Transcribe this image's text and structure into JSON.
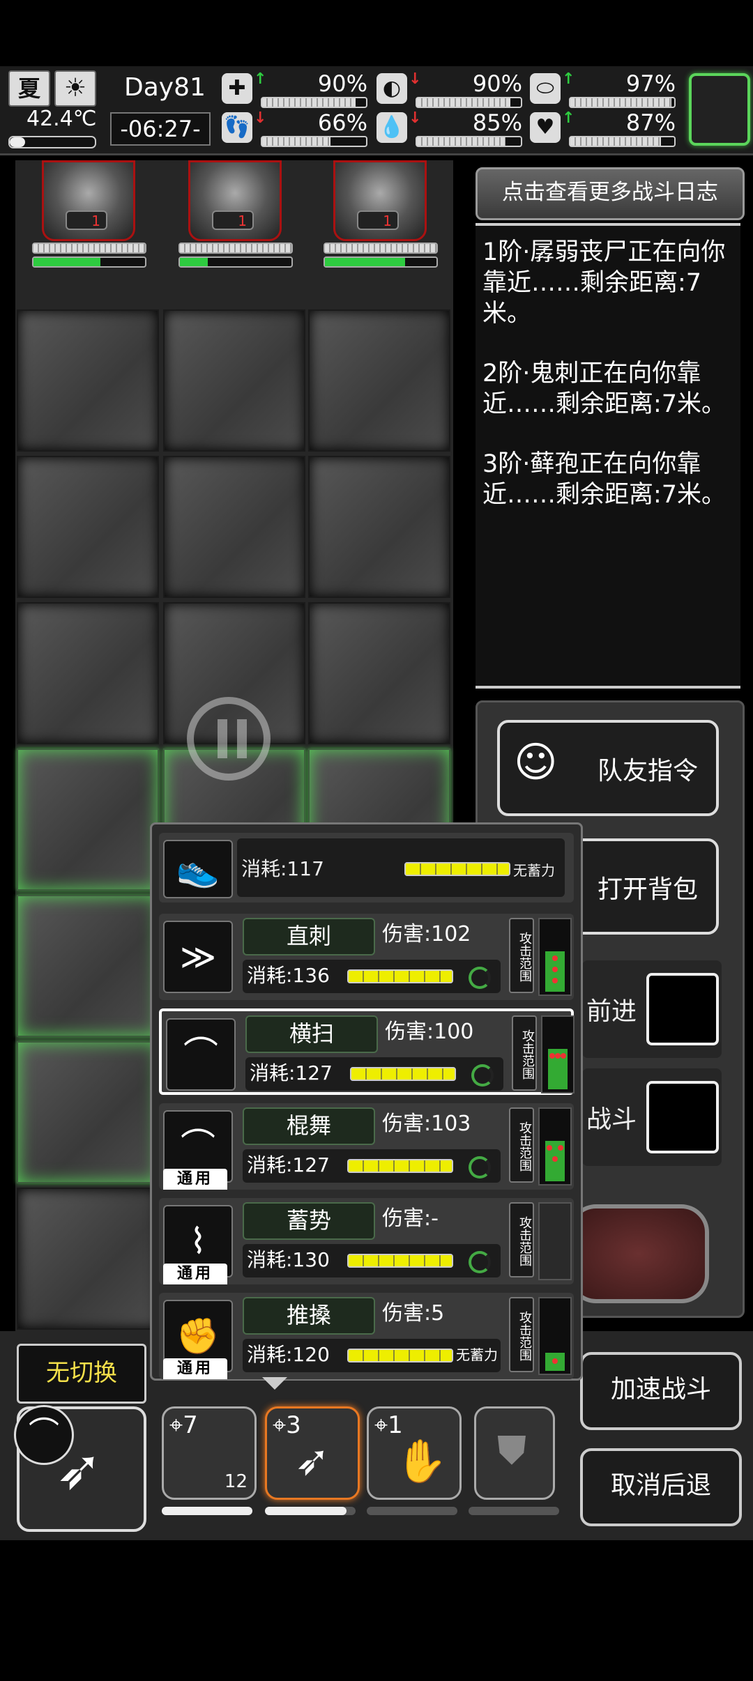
{
  "hud": {
    "season": "夏",
    "temperature": "42.4℃",
    "day": "Day81",
    "time": "-06:27-",
    "stats": [
      {
        "icon": "medkit-icon",
        "arrow": "↑",
        "arrow_color": "#2ecc40",
        "value": "90%",
        "level": 0.9
      },
      {
        "icon": "stomach-icon",
        "arrow": "↓",
        "arrow_color": "#e03030",
        "value": "90%",
        "level": 0.9
      },
      {
        "icon": "pill-icon",
        "arrow": "↑",
        "arrow_color": "#2ecc40",
        "value": "97%",
        "level": 0.97
      },
      {
        "icon": "foot-icon",
        "arrow": "↓",
        "arrow_color": "#e03030",
        "value": "66%",
        "level": 0.66
      },
      {
        "icon": "water-drop-icon",
        "arrow": "↓",
        "arrow_color": "#e03030",
        "value": "85%",
        "level": 0.85
      },
      {
        "icon": "heart-icon",
        "arrow": "↑",
        "arrow_color": "#2ecc40",
        "value": "87%",
        "level": 0.87
      }
    ]
  },
  "enemies": [
    {
      "level": "1",
      "hp": 0.6
    },
    {
      "level": "1",
      "hp": 0.25
    },
    {
      "level": "1",
      "hp": 0.72
    }
  ],
  "log": {
    "button": "点击查看更多战斗日志",
    "entries": [
      "1阶·孱弱丧尸正在向你靠近……剩余距离:7米。",
      "2阶·鬼刺正在向你靠近……剩余距离:7米。",
      "3阶·藓孢正在向你靠近……剩余距离:7米。"
    ]
  },
  "right_panel": {
    "teammate_cmd": "队友指令",
    "open_bag": "打开背包",
    "advance": "前进",
    "fight": "战斗"
  },
  "popup": {
    "move": {
      "cost": "消耗:117",
      "note": "无蓄力"
    },
    "range_label": "攻击范围",
    "skills": [
      {
        "name": "直刺",
        "damage": "伤害:102",
        "cost": "消耗:136",
        "common": "",
        "note": ""
      },
      {
        "name": "横扫",
        "damage": "伤害:100",
        "cost": "消耗:127",
        "common": "",
        "note": ""
      },
      {
        "name": "棍舞",
        "damage": "伤害:103",
        "cost": "消耗:127",
        "common": "通用",
        "note": ""
      },
      {
        "name": "蓄势",
        "damage": "伤害:-",
        "cost": "消耗:130",
        "common": "通用",
        "note": ""
      },
      {
        "name": "推搡",
        "damage": "伤害:5",
        "cost": "消耗:120",
        "common": "通用",
        "note": "无蓄力"
      }
    ]
  },
  "bottom": {
    "no_switch": "无切换",
    "weapons": [
      {
        "count": "7",
        "ammo": "12",
        "durability": 1.0
      },
      {
        "count": "3",
        "ammo": "",
        "durability": 0.9
      },
      {
        "count": "1",
        "ammo": "",
        "durability": 0.0
      },
      {
        "count": "",
        "ammo": "",
        "durability": 0.0
      }
    ],
    "speed_up": "加速战斗",
    "cancel_retreat": "取消后退"
  }
}
